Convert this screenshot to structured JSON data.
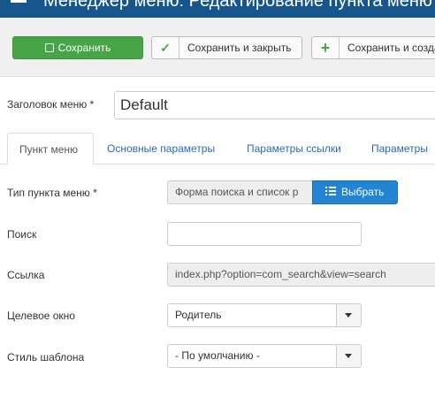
{
  "header": {
    "title": "Менеджер меню: Редактирование пункта меню"
  },
  "toolbar": {
    "save_label": "Сохранить",
    "save_close_label": "Сохранить и закрыть",
    "save_copy_label": "Сохранить и созда"
  },
  "menu_title": {
    "label": "Заголовок меню *",
    "value": "Default"
  },
  "tabs": [
    {
      "label": "Пункт меню"
    },
    {
      "label": "Основные параметры"
    },
    {
      "label": "Параметры ссылки"
    },
    {
      "label": "Параметры"
    }
  ],
  "form": {
    "type": {
      "label": "Тип пункта меню *",
      "value": "Форма поиска и список р",
      "button": "Выбрать"
    },
    "search": {
      "label": "Поиск",
      "value": ""
    },
    "link": {
      "label": "Ссылка",
      "value": "index.php?option=com_search&view=search"
    },
    "target": {
      "label": "Целевое окно",
      "value": "Родитель"
    },
    "template": {
      "label": "Стиль шаблона",
      "value": "- По умолчанию -"
    }
  },
  "colors": {
    "header": "#17568c",
    "save": "#46a546",
    "primary": "#2384d3",
    "link": "#2a69b8"
  }
}
